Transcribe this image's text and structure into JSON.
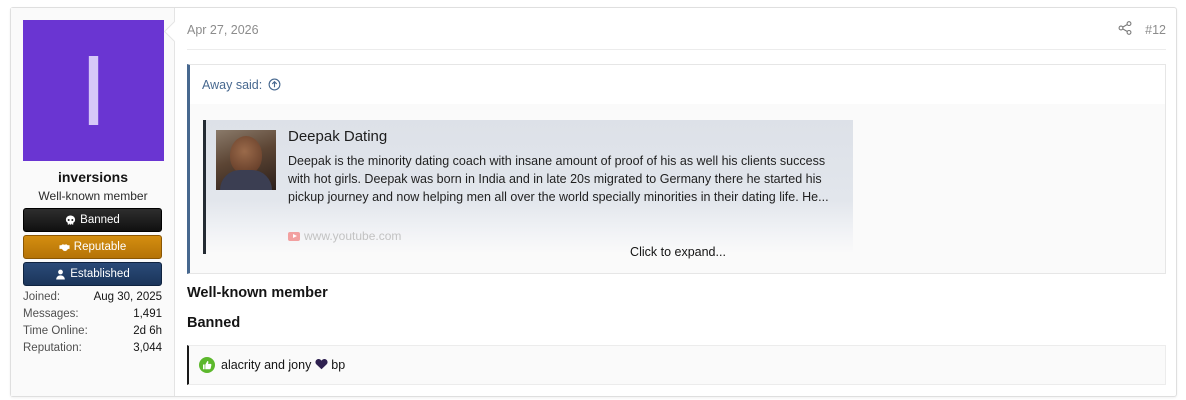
{
  "user": {
    "avatar_letter": "I",
    "avatar_color": "#6a35d2",
    "username": "inversions",
    "title": "Well-known member",
    "banners": [
      {
        "label": "Banned",
        "icon": "skull-icon"
      },
      {
        "label": "Reputable",
        "icon": "handshake-icon"
      },
      {
        "label": "Established",
        "icon": "user-icon"
      }
    ],
    "stats": [
      {
        "label": "Joined:",
        "value": "Aug 30, 2025"
      },
      {
        "label": "Messages:",
        "value": "1,491"
      },
      {
        "label": "Time Online:",
        "value": "2d 6h"
      },
      {
        "label": "Reputation:",
        "value": "3,044"
      }
    ]
  },
  "post": {
    "date": "Apr 27, 2026",
    "number": "#12",
    "quote": {
      "author_said": "Away said:",
      "embed": {
        "title": "Deepak Dating",
        "description": "Deepak is the minority dating coach with insane amount of proof of his as well his clients success with hot girls. Deepak was born in India and in late 20s migrated to Germany there he started his pickup journey and now helping men all over the world specially minorities in their dating life. He...",
        "source": "www.youtube.com"
      },
      "expand_label": "Click to expand..."
    },
    "signature": [
      "Well-known member",
      "Banned"
    ],
    "reactions": {
      "text_before": "alacrity and jony",
      "text_after": "bp"
    }
  }
}
